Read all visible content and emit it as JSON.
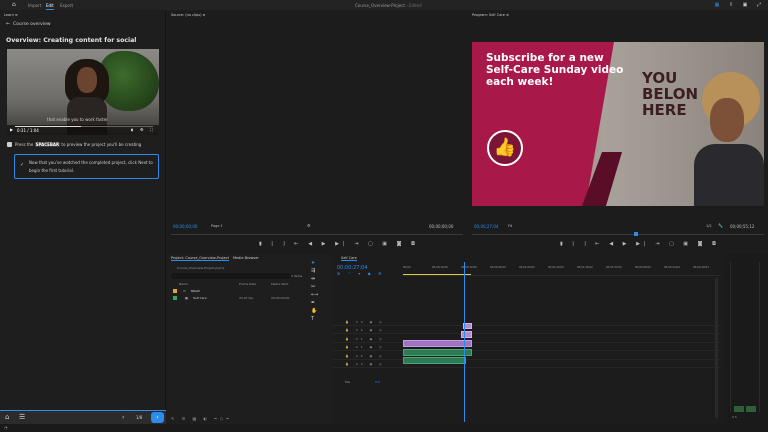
{
  "topbar": {
    "workspaces": [
      "Import",
      "Edit",
      "Export"
    ],
    "active_workspace": "Edit",
    "document_title": "Course_Overview-Project",
    "document_status": "Edited"
  },
  "learn": {
    "panel_title": "Learn",
    "back_label": "Course overview",
    "heading": "Overview: Creating content for social",
    "video": {
      "time": "0:31 / 1:04",
      "caption": "that enable you to work faster",
      "progress": 0.48
    },
    "step_prefix": "Press the",
    "step_key": "SPACEBAR",
    "step_suffix": "to preview the project you'll be creating",
    "card_line1": "Now that you've watched the completed project, click Next to",
    "card_line2": "begin the first tutorial.",
    "page": "1/8"
  },
  "source": {
    "title": "Source: (no clips)",
    "timecode_left": "00;00;00;00",
    "page": "Page 1",
    "timecode_right": "00;00;00;00"
  },
  "program": {
    "title": "Program: Self Care",
    "timecode_left": "00;00;27;04",
    "fit": "Fit",
    "ratio": "1/2",
    "timecode_right": "00;00;55;12",
    "frame": {
      "headline": "Subscribe for a new Self-Care Sunday video each week!",
      "wall_text": "YOU BELON HERE"
    }
  },
  "project": {
    "tab1": "Project: Course_Overview-Project",
    "tab2": "Media Browser",
    "path": "Course_Overview-Project.prproj",
    "count": "2 items",
    "columns": [
      "Name",
      "Frame Rate",
      "Media Start"
    ],
    "rows": [
      {
        "name": "BRAW",
        "rate": "",
        "start": ""
      },
      {
        "name": "Self Care",
        "rate": "29.97 fps",
        "start": "00;00;00;00"
      }
    ]
  },
  "timeline": {
    "tab": "Self Care",
    "timecode": "00;00;27;04",
    "ruler": [
      "00;00",
      "00;00;16;00",
      "00;00;32;00",
      "00;00;48;00",
      "00;01;04;02",
      "00;01;20;02",
      "00;01;36;02",
      "00;01;52;02",
      "00;02;08;04",
      "00;02;24;04",
      "00;02;40;04"
    ],
    "video_tracks": [
      "V3",
      "V2",
      "V1"
    ],
    "audio_tracks": [
      "A1",
      "A2",
      "A3"
    ],
    "mix_label": "Mix",
    "mix_value": "0.0"
  },
  "colors": {
    "accent": "#2d8ceb",
    "brand_pink": "#a8194a",
    "clip_purple": "#b68ccf",
    "clip_green": "#2e7a55"
  }
}
